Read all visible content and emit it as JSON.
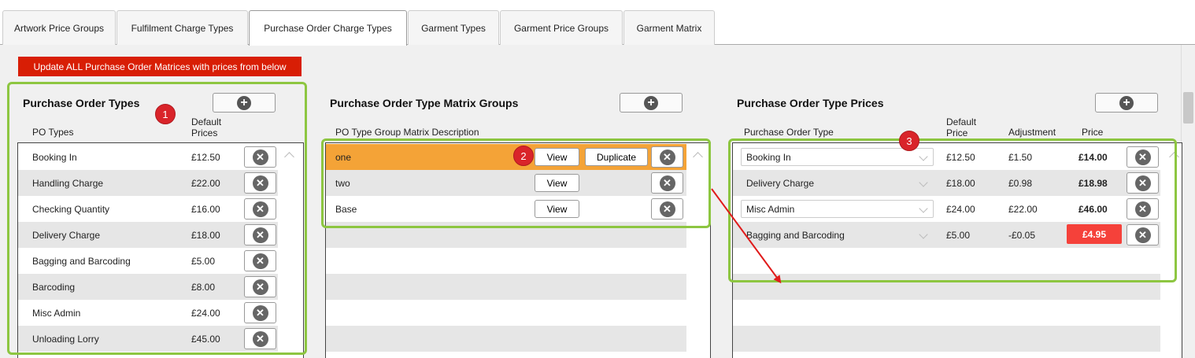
{
  "tabs": [
    {
      "label": "Artwork Price Groups"
    },
    {
      "label": "Fulfilment Charge Types"
    },
    {
      "label": "Purchase Order Charge Types",
      "active": true
    },
    {
      "label": "Garment Types"
    },
    {
      "label": "Garment Price Groups"
    },
    {
      "label": "Garment Matrix"
    }
  ],
  "update_all_label": "Update ALL Purchase Order Matrices with prices from below",
  "po_types": {
    "title": "Purchase Order Types",
    "col_type": "PO Types",
    "col_price_line1": "Default",
    "col_price_line2": "Prices",
    "rows": [
      {
        "name": "Booking In",
        "price": "£12.50"
      },
      {
        "name": "Handling Charge",
        "price": "£22.00"
      },
      {
        "name": "Checking Quantity",
        "price": "£16.00"
      },
      {
        "name": "Delivery Charge",
        "price": "£18.00"
      },
      {
        "name": "Bagging and Barcoding",
        "price": "£5.00"
      },
      {
        "name": "Barcoding",
        "price": "£8.00"
      },
      {
        "name": "Misc Admin",
        "price": "£24.00"
      },
      {
        "name": "Unloading Lorry",
        "price": "£45.00"
      }
    ]
  },
  "matrix_groups": {
    "title": "Purchase Order Type Matrix Groups",
    "col_desc": "PO Type Group Matrix Description",
    "view_label": "View",
    "duplicate_label": "Duplicate",
    "rows": [
      {
        "name": "one",
        "selected": true
      },
      {
        "name": "two"
      },
      {
        "name": "Base"
      }
    ]
  },
  "type_prices": {
    "title": "Purchase Order Type Prices",
    "col_type": "Purchase Order Type",
    "col_default_line1": "Default",
    "col_default_line2": "Price",
    "col_adjustment": "Adjustment",
    "col_price": "Price",
    "rows": [
      {
        "type": "Booking In",
        "default": "£12.50",
        "adjustment": "£1.50",
        "price": "£14.00"
      },
      {
        "type": "Delivery Charge",
        "default": "£18.00",
        "adjustment": "£0.98",
        "price": "£18.98"
      },
      {
        "type": "Misc Admin",
        "default": "£24.00",
        "adjustment": "£22.00",
        "price": "£46.00"
      },
      {
        "type": "Bagging and Barcoding",
        "default": "£5.00",
        "adjustment": "-£0.05",
        "price": "£4.95",
        "highlight": true
      }
    ]
  },
  "annotations": {
    "badges": [
      "1",
      "2",
      "3"
    ],
    "highlight_color": "#8dc641",
    "badge_color": "#d9242a",
    "arrow_color": "#e01b1b"
  },
  "colors": {
    "update_button": "#d81e05",
    "selected_row": "#f4a337",
    "negative_price": "#f5413a"
  }
}
